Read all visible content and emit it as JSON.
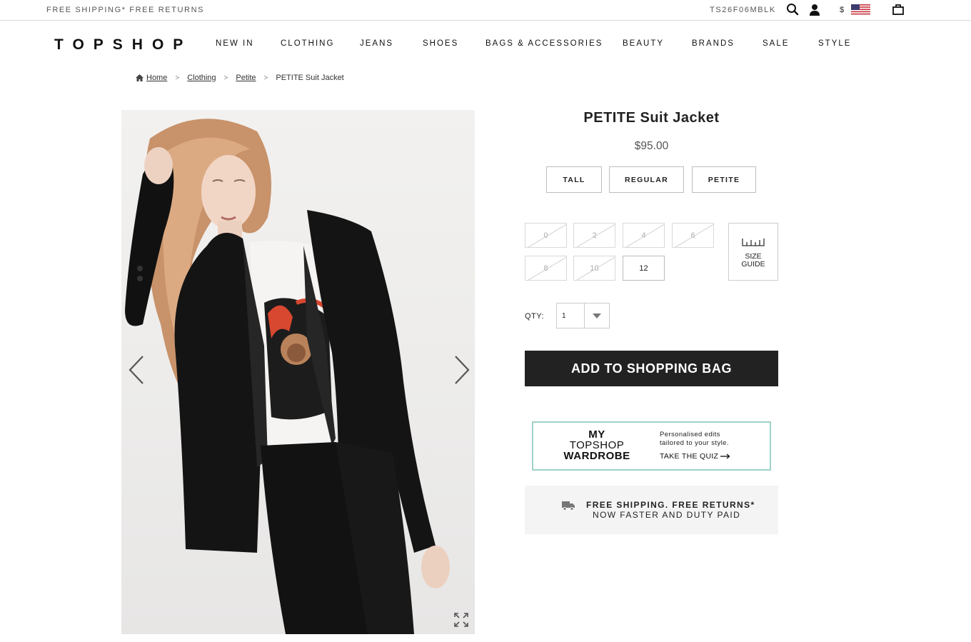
{
  "topbar": {
    "promo": "FREE SHIPPING* FREE RETURNS",
    "product_code": "TS26F06MBLK",
    "currency_symbol": "$",
    "icons": [
      "search-icon",
      "account-icon",
      "us-flag-icon",
      "shopping-bag-icon"
    ]
  },
  "nav": {
    "logo": "TOPSHOP",
    "items": [
      "NEW IN",
      "CLOTHING",
      "JEANS",
      "SHOES",
      "BAGS & ACCESSORIES",
      "BEAUTY",
      "BRANDS",
      "SALE",
      "STYLE"
    ]
  },
  "breadcrumb": {
    "items": [
      "Home",
      "Clothing",
      "Petite"
    ],
    "current": "PETITE Suit Jacket",
    "separator": ">"
  },
  "product": {
    "title": "PETITE Suit Jacket",
    "price": "$95.00",
    "fits": [
      "TALL",
      "REGULAR",
      "PETITE"
    ],
    "sizes": [
      {
        "label": "0",
        "available": false
      },
      {
        "label": "2",
        "available": false
      },
      {
        "label": "4",
        "available": false
      },
      {
        "label": "6",
        "available": false
      },
      {
        "label": "8",
        "available": false
      },
      {
        "label": "10",
        "available": false
      },
      {
        "label": "12",
        "available": true
      }
    ],
    "size_guide_line1": "SIZE",
    "size_guide_line2": "GUIDE",
    "qty_label": "QTY:",
    "qty_value": "1",
    "add_to_bag": "ADD TO SHOPPING BAG"
  },
  "wardrobe_promo": {
    "line1": "MY",
    "line2": "TOPSHOP",
    "line3": "WARDROBE",
    "tagline_1": "Personalised edits",
    "tagline_2": "tailored to your style.",
    "cta": "TAKE THE QUIZ"
  },
  "shipping_banner": {
    "line1": "FREE SHIPPING. FREE RETURNS*",
    "line2": "NOW FASTER AND DUTY PAID"
  },
  "colors": {
    "button_bg": "#222222",
    "wardrobe_border": "#9fd2c8",
    "shipping_bg": "#f4f4f4"
  }
}
